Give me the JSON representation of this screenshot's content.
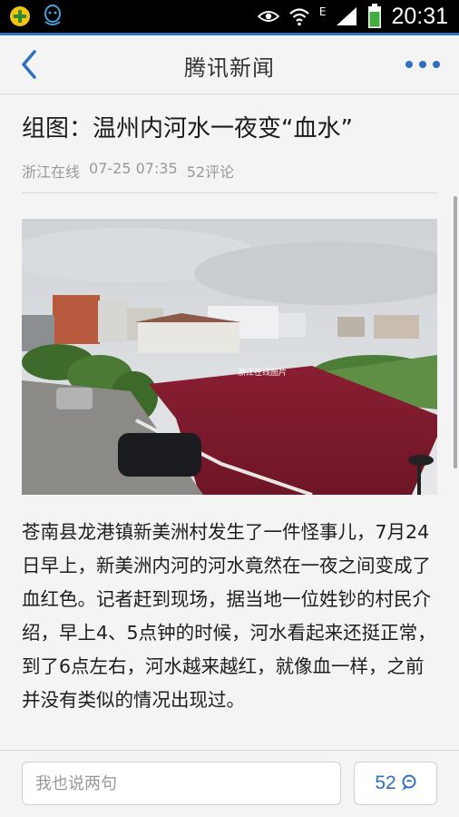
{
  "status_bar": {
    "time": "20:31",
    "network_label": "E",
    "icons": [
      "app-plus-icon",
      "qq-icon",
      "eye-icon",
      "wifi-icon",
      "signal-icon",
      "battery-icon"
    ]
  },
  "nav": {
    "title": "腾讯新闻",
    "back_icon": "back-arrow-icon",
    "more_icon": "more-dots-icon",
    "accent_color": "#2d6fc0"
  },
  "article": {
    "headline": "组图：温州内河水一夜变“血水”",
    "source": "浙江在线",
    "datetime": "07-25 07:35",
    "comments_label": "52评论",
    "photo_watermark": "浙江在线图片",
    "body": "苍南县龙港镇新美洲村发生了一件怪事儿，7月24日早上，新美洲内河的河水竟然在一夜之间变成了血红色。记者赶到现场，据当地一位姓钞的村民介绍，早上4、5点钟的时候，河水看起来还挺正常，到了6点左右，河水越来越红，就像血一样，之前并没有类似的情况出现过。"
  },
  "comment_bar": {
    "placeholder": "我也说两句",
    "count": "52",
    "count_icon": "comment-bubble-icon"
  }
}
